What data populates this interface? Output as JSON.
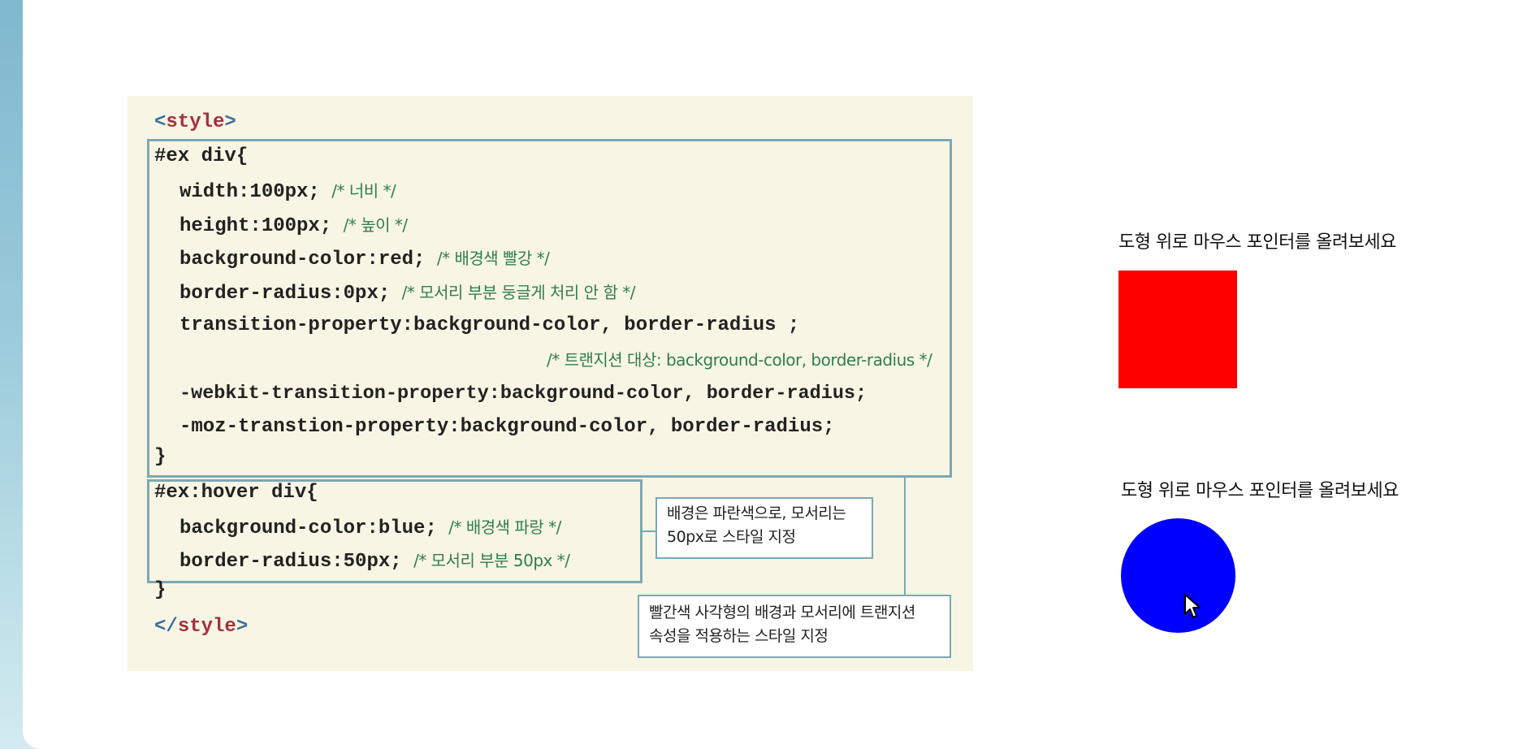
{
  "code": {
    "style_open": {
      "bracket_open": "<",
      "tag": "style",
      "bracket_close": ">"
    },
    "style_close": {
      "bracket_open": "</",
      "tag": "style",
      "bracket_close": ">"
    },
    "block1": {
      "selector": "#ex div{",
      "width": {
        "code": "width:100px;",
        "comment": "/* 너비 */"
      },
      "height": {
        "code": "height:100px;",
        "comment": "/* 높이 */"
      },
      "bg": {
        "code": "background-color:red;",
        "comment": "/* 배경색 빨강 */"
      },
      "radius": {
        "code": "border-radius:0px;",
        "comment": "/* 모서리 부분 둥글게 처리 안 함 */"
      },
      "transition": {
        "code": "transition-property:background-color, border-radius ;"
      },
      "transition_comment": "/* 트랜지션 대상: background-color, border-radius */",
      "webkit": {
        "code": "-webkit-transition-property:background-color, border-radius;"
      },
      "moz": {
        "code": "-moz-transtion-property:background-color, border-radius;"
      },
      "close": "}"
    },
    "block2": {
      "selector": "#ex:hover div{",
      "bg": {
        "code": "background-color:blue;",
        "comment": "/* 배경색 파랑 */"
      },
      "radius": {
        "code": "border-radius:50px;",
        "comment": "/* 모서리 부분 50px */"
      },
      "close": "}"
    }
  },
  "callouts": {
    "hover": [
      "배경은 파란색으로, 모서리는",
      "50px로 스타일 지정"
    ],
    "transition": [
      "빨간색 사각형의 배경과 모서리에 트랜지션",
      "속성을 적용하는 스타일 지정"
    ]
  },
  "demo": {
    "label_before": "도형 위로 마우스 포인터를 올려보세요",
    "label_after": "도형 위로 마우스 포인터를 올려보세요",
    "shape_before_color": "#ff0000",
    "shape_after_color": "#0000ff"
  },
  "colors": {
    "panel_bg": "#f8f5e4",
    "box_border": "#7ba9b2",
    "comment": "#2f7d52",
    "tag": "#a0323e"
  }
}
